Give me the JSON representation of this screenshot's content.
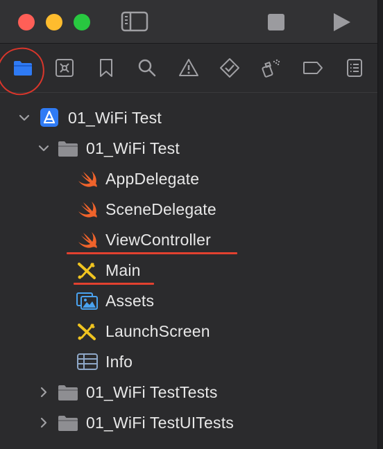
{
  "window": {
    "traffic_lights": [
      "close",
      "minimize",
      "zoom"
    ]
  },
  "toolbar": {
    "icons": [
      "sidebar-toggle-icon",
      "stop-icon",
      "run-icon"
    ]
  },
  "navigator_tabs": [
    {
      "name": "project-navigator",
      "icon": "folder-icon",
      "selected": true
    },
    {
      "name": "source-control-navigator",
      "icon": "source-control-icon"
    },
    {
      "name": "bookmark-navigator",
      "icon": "bookmark-icon"
    },
    {
      "name": "find-navigator",
      "icon": "search-icon"
    },
    {
      "name": "issue-navigator",
      "icon": "warning-icon"
    },
    {
      "name": "test-navigator",
      "icon": "test-diamond-icon"
    },
    {
      "name": "debug-navigator",
      "icon": "spray-icon"
    },
    {
      "name": "breakpoint-navigator",
      "icon": "breakpoint-icon"
    },
    {
      "name": "report-navigator",
      "icon": "report-icon"
    }
  ],
  "tree": {
    "project": {
      "label": "01_WiFi Test",
      "expanded": true
    },
    "group": {
      "label": "01_WiFi Test",
      "expanded": true
    },
    "files": [
      {
        "label": "AppDelegate",
        "icon": "swift-icon"
      },
      {
        "label": "SceneDelegate",
        "icon": "swift-icon"
      },
      {
        "label": "ViewController",
        "icon": "swift-icon"
      },
      {
        "label": "Main",
        "icon": "storyboard-icon"
      },
      {
        "label": "Assets",
        "icon": "assets-icon"
      },
      {
        "label": "LaunchScreen",
        "icon": "storyboard-icon"
      },
      {
        "label": "Info",
        "icon": "plist-icon"
      }
    ],
    "collapsed_groups": [
      {
        "label": "01_WiFi TestTests",
        "expanded": false
      },
      {
        "label": "01_WiFi TestUITests",
        "expanded": false
      }
    ]
  },
  "colors": {
    "accent": "#2f7bf5",
    "annotation": "#e2412f",
    "swift": "#f0632b",
    "storyboard": "#f0c420",
    "folder": "#8e8e92"
  }
}
